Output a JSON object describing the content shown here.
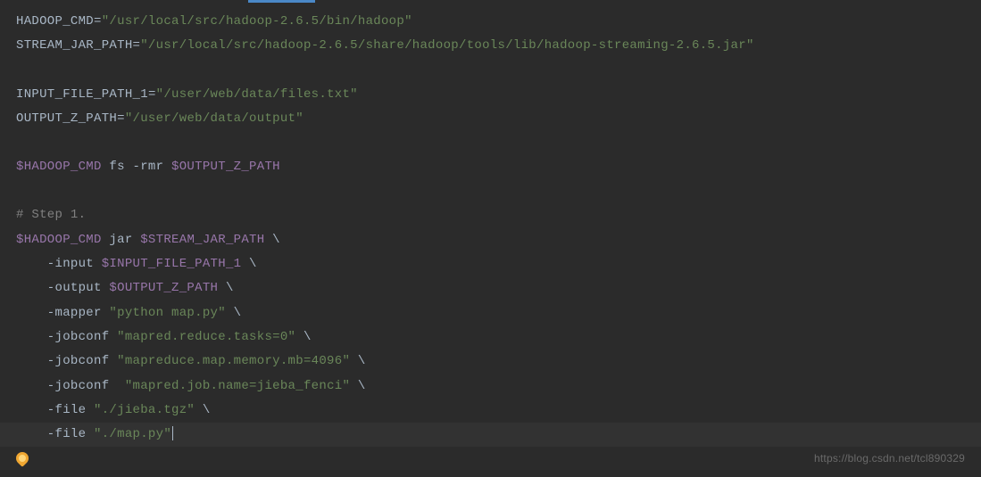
{
  "code": {
    "line1": {
      "var": "HADOOP_CMD",
      "eq": "=",
      "val": "\"/usr/local/src/hadoop-2.6.5/bin/hadoop\""
    },
    "line2": {
      "var": "STREAM_JAR_PATH",
      "eq": "=",
      "val": "\"/usr/local/src/hadoop-2.6.5/share/hadoop/tools/lib/hadoop-streaming-2.6.5.jar\""
    },
    "line3": {
      "var": "INPUT_FILE_PATH_1",
      "eq": "=",
      "val": "\"/user/web/data/files.txt\""
    },
    "line4": {
      "var": "OUTPUT_Z_PATH",
      "eq": "=",
      "val": "\"/user/web/data/output\""
    },
    "line5": {
      "ref1": "$HADOOP_CMD",
      "txt1": " fs -rmr ",
      "ref2": "$OUTPUT_Z_PATH"
    },
    "line6": {
      "comment": "# Step 1."
    },
    "line7": {
      "ref1": "$HADOOP_CMD",
      "txt1": " jar ",
      "ref2": "$STREAM_JAR_PATH",
      "txt2": " \\"
    },
    "line8": {
      "txt1": "    -input ",
      "ref1": "$INPUT_FILE_PATH_1",
      "txt2": " \\"
    },
    "line9": {
      "txt1": "    -output ",
      "ref1": "$OUTPUT_Z_PATH",
      "txt2": " \\"
    },
    "line10": {
      "txt1": "    -mapper ",
      "val": "\"python map.py\"",
      "txt2": " \\"
    },
    "line11": {
      "txt1": "    -jobconf ",
      "val": "\"mapred.reduce.tasks=0\"",
      "txt2": " \\"
    },
    "line12": {
      "txt1": "    -jobconf ",
      "val": "\"mapreduce.map.memory.mb=4096\"",
      "txt2": " \\"
    },
    "line13": {
      "txt1": "    -jobconf  ",
      "val": "\"mapred.job.name=jieba_fenci\"",
      "txt2": " \\"
    },
    "line14": {
      "txt1": "    -file ",
      "val": "\"./jieba.tgz\"",
      "txt2": " \\"
    },
    "line15": {
      "txt1": "    -file ",
      "val": "\"./map.py\""
    }
  },
  "watermark": "https://blog.csdn.net/tcl890329"
}
